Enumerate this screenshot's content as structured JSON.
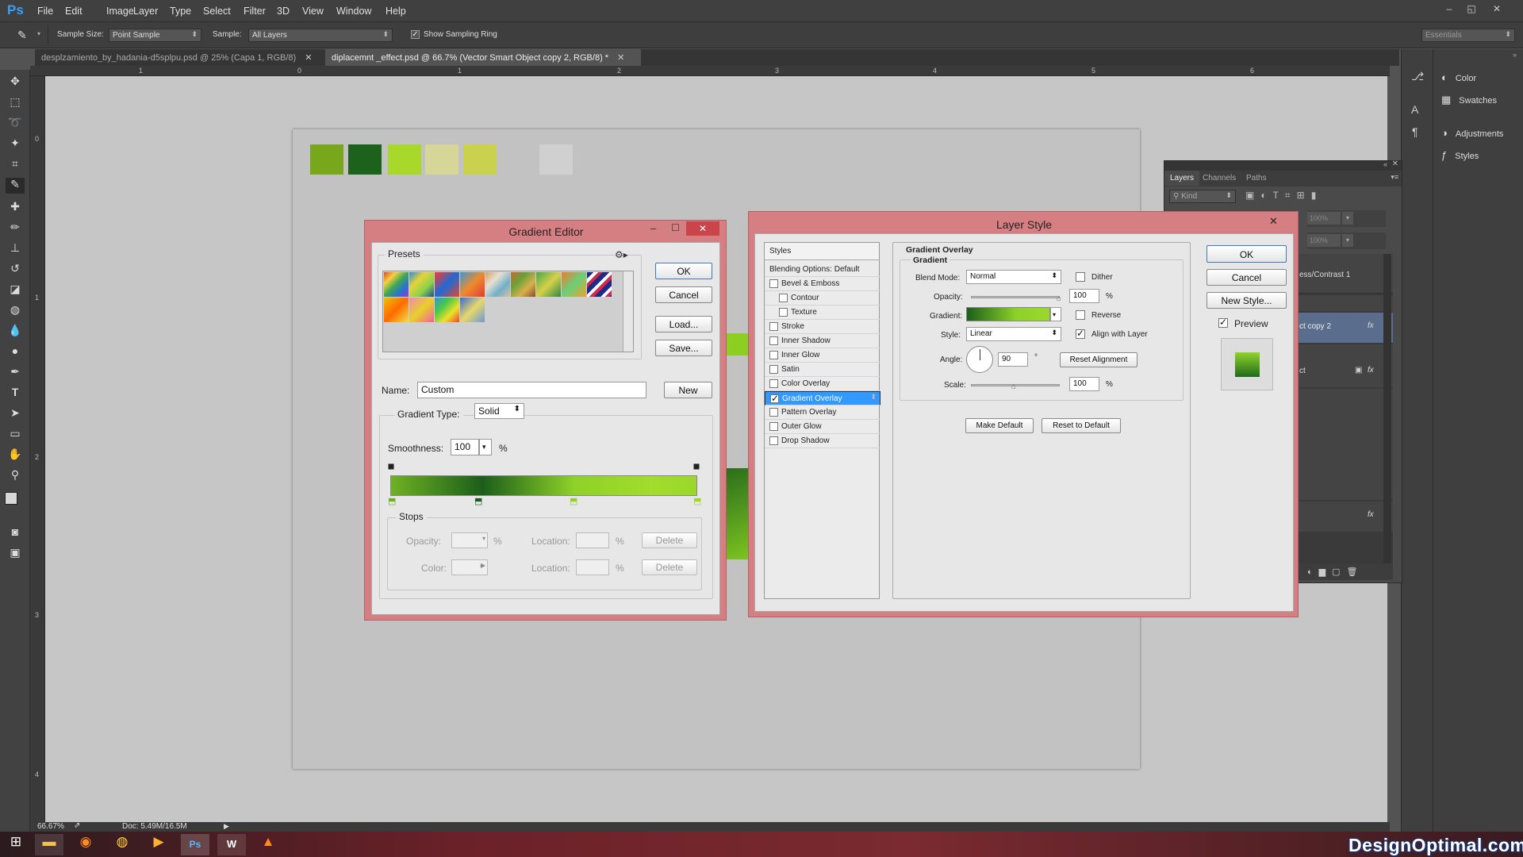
{
  "app": {
    "logo": "Ps",
    "menus": [
      "File",
      "Edit",
      "Image",
      "Layer",
      "Type",
      "Select",
      "Filter",
      "3D",
      "View",
      "Window",
      "Help"
    ],
    "window_controls": [
      "–",
      "◱",
      "✕"
    ]
  },
  "options": {
    "sample_size_label": "Sample Size:",
    "sample_size_value": "Point Sample",
    "sample_label": "Sample:",
    "sample_value": "All Layers",
    "show_ring_label": "Show Sampling Ring",
    "workspace": "Essentials"
  },
  "tabs": [
    {
      "label": "desplzamiento_by_hadania-d5splpu.psd @ 25% (Capa 1, RGB/8)"
    },
    {
      "label": "diplacemnt _effect.psd @ 66.7% (Vector Smart Object copy 2, RGB/8) *"
    }
  ],
  "rulers": {
    "h": [
      "1",
      "0",
      "1",
      "2",
      "3",
      "4",
      "5",
      "6"
    ],
    "v": [
      "0",
      "1",
      "2",
      "3",
      "4"
    ]
  },
  "swatch_colors": [
    "#78a71c",
    "#1c611c",
    "#a7d82a",
    "#d5d697",
    "#c9d14e",
    "#cfd0cf"
  ],
  "status": {
    "zoom": "66.67%",
    "doc": "Doc: 5.49M/16.5M"
  },
  "right_panel": {
    "items": [
      {
        "label": "Color",
        "icon": "color-wheel-icon"
      },
      {
        "label": "Swatches",
        "icon": "swatches-grid-icon"
      },
      {
        "label": "Adjustments",
        "icon": "adjustments-icon"
      },
      {
        "label": "Styles",
        "icon": "fx-styles-icon"
      }
    ]
  },
  "layers_panel": {
    "tabs": [
      "Layers",
      "Channels",
      "Paths"
    ],
    "kind": "Kind",
    "opacity_pct": "100%",
    "fill_pct": "100%",
    "rows": [
      "ess/Contrast 1",
      "ct copy 2",
      "ct"
    ],
    "fx": "fx"
  },
  "gradient_editor": {
    "title": "Gradient Editor",
    "presets_label": "Presets",
    "ok": "OK",
    "cancel": "Cancel",
    "load": "Load...",
    "save": "Save...",
    "name_label": "Name:",
    "name_value": "Custom",
    "new": "New",
    "gradient_type_label": "Gradient Type:",
    "gradient_type_value": "Solid",
    "smoothness_label": "Smoothness:",
    "smoothness_value": "100",
    "pct": "%",
    "stops_label": "Stops",
    "opacity_label": "Opacity:",
    "location_label": "Location:",
    "color_label": "Color:",
    "delete": "Delete",
    "gradient_colors": [
      "#6fb124",
      "#1b5e1a",
      "#8ed129",
      "#a2dc2c",
      "#9bd82b"
    ]
  },
  "layer_style": {
    "title": "Layer Style",
    "styles_header": "Styles",
    "items": [
      {
        "label": "Blending Options: Default",
        "check": false,
        "nocheck": true,
        "indent": false,
        "selected": false
      },
      {
        "label": "Bevel & Emboss",
        "check": false,
        "indent": false,
        "selected": false
      },
      {
        "label": "Contour",
        "check": false,
        "indent": true,
        "selected": false
      },
      {
        "label": "Texture",
        "check": false,
        "indent": true,
        "selected": false
      },
      {
        "label": "Stroke",
        "check": false,
        "indent": false,
        "selected": false
      },
      {
        "label": "Inner Shadow",
        "check": false,
        "indent": false,
        "selected": false
      },
      {
        "label": "Inner Glow",
        "check": false,
        "indent": false,
        "selected": false
      },
      {
        "label": "Satin",
        "check": false,
        "indent": false,
        "selected": false
      },
      {
        "label": "Color Overlay",
        "check": false,
        "indent": false,
        "selected": false
      },
      {
        "label": "Gradient Overlay",
        "check": true,
        "indent": false,
        "selected": true
      },
      {
        "label": "Pattern Overlay",
        "check": false,
        "indent": false,
        "selected": false
      },
      {
        "label": "Outer Glow",
        "check": false,
        "indent": false,
        "selected": false
      },
      {
        "label": "Drop Shadow",
        "check": false,
        "indent": false,
        "selected": false
      }
    ],
    "section_title": "Gradient Overlay",
    "subsection": "Gradient",
    "blend_mode_label": "Blend Mode:",
    "blend_mode_value": "Normal",
    "dither": "Dither",
    "opacity_label": "Opacity:",
    "opacity_value": "100",
    "gradient_label": "Gradient:",
    "reverse": "Reverse",
    "style_label": "Style:",
    "style_value": "Linear",
    "align": "Align with Layer",
    "angle_label": "Angle:",
    "angle_value": "90",
    "degree": "°",
    "reset_alignment": "Reset Alignment",
    "scale_label": "Scale:",
    "scale_value": "100",
    "pct": "%",
    "make_default": "Make Default",
    "reset_default": "Reset to Default",
    "ok": "OK",
    "cancel": "Cancel",
    "new_style": "New Style...",
    "preview": "Preview"
  },
  "watermark": "DesignOptimal.com"
}
